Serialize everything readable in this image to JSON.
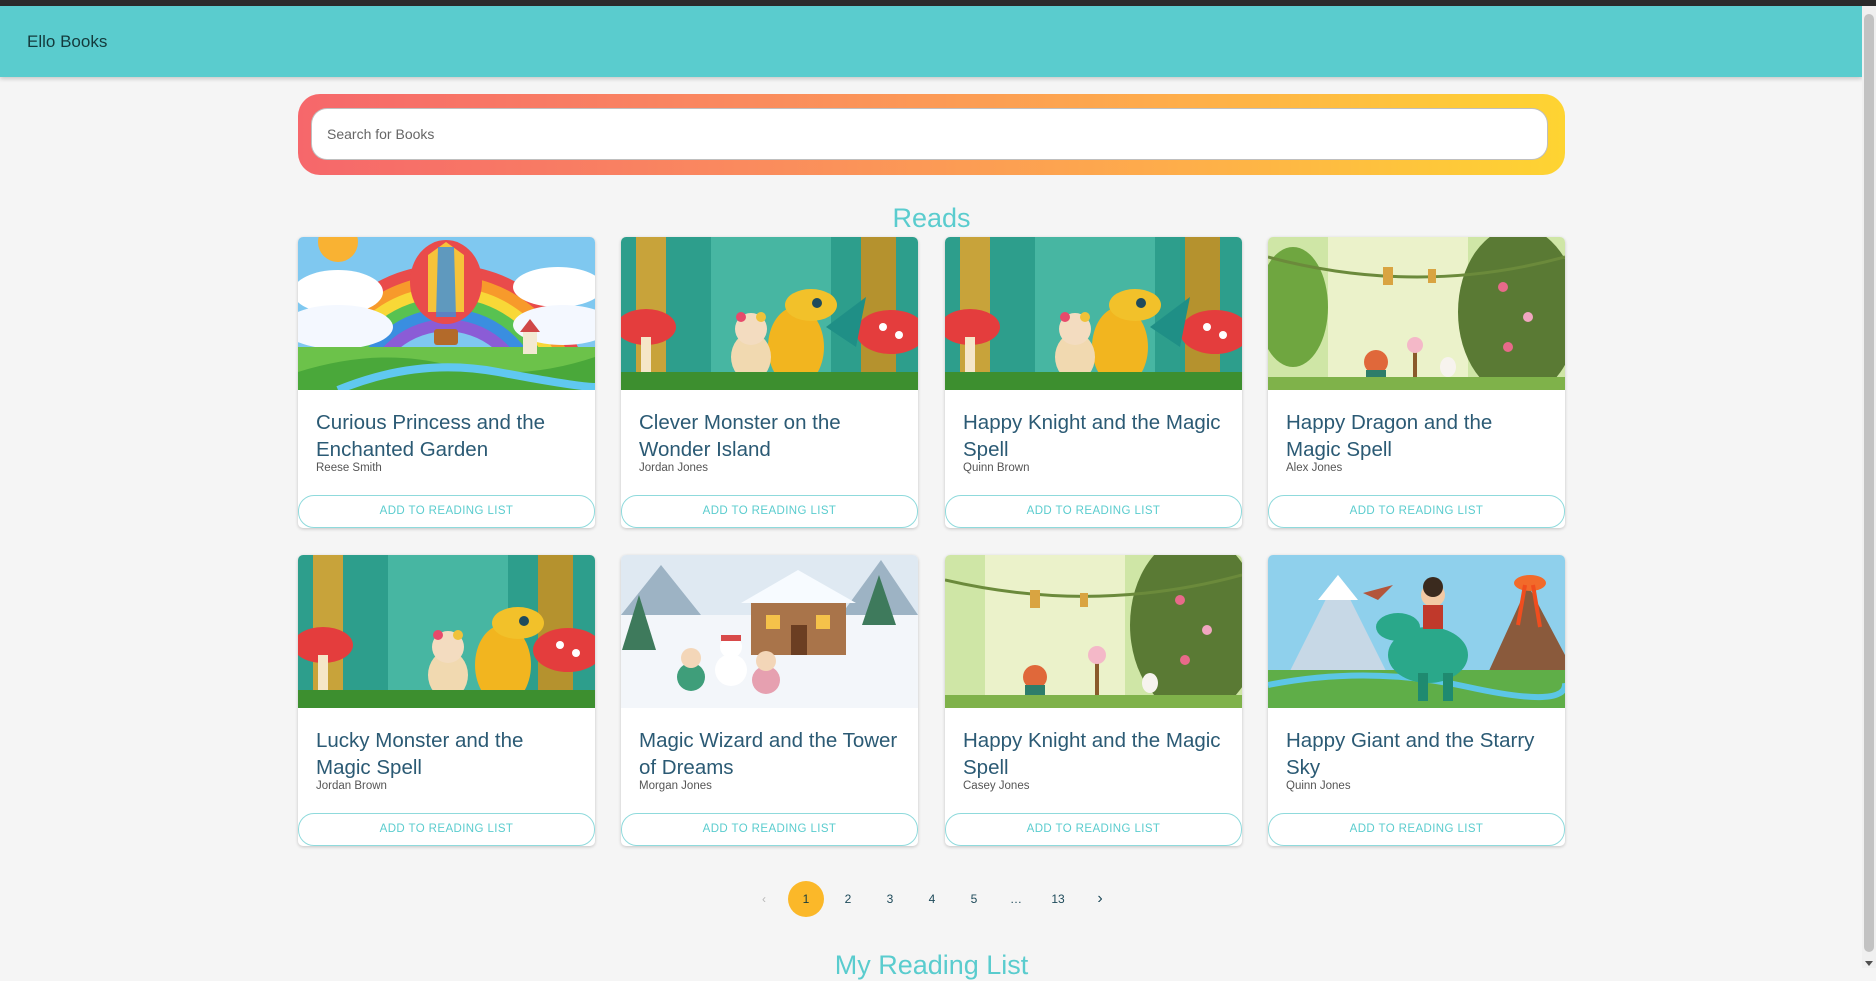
{
  "app": {
    "title": "Ello Books"
  },
  "search": {
    "placeholder": "Search for Books"
  },
  "sections": {
    "reads_title": "Reads",
    "reading_list_title": "My Reading List"
  },
  "books": [
    {
      "title": "Curious Princess and the Enchanted Garden",
      "author": "Reese Smith",
      "action": "ADD TO READING LIST",
      "cover": "rainbow-balloon"
    },
    {
      "title": "Clever Monster on the Wonder Island",
      "author": "Jordan Jones",
      "action": "ADD TO READING LIST",
      "cover": "dragon-forest"
    },
    {
      "title": "Happy Knight and the Magic Spell",
      "author": "Quinn Brown",
      "action": "ADD TO READING LIST",
      "cover": "dragon-forest"
    },
    {
      "title": "Happy Dragon and the Magic Spell",
      "author": "Alex Jones",
      "action": "ADD TO READING LIST",
      "cover": "tea-party-garden"
    },
    {
      "title": "Lucky Monster and the Magic Spell",
      "author": "Jordan Brown",
      "action": "ADD TO READING LIST",
      "cover": "dragon-forest"
    },
    {
      "title": "Magic Wizard and the Tower of Dreams",
      "author": "Morgan Jones",
      "action": "ADD TO READING LIST",
      "cover": "snow-cabin"
    },
    {
      "title": "Happy Knight and the Magic Spell",
      "author": "Casey Jones",
      "action": "ADD TO READING LIST",
      "cover": "tea-party-garden"
    },
    {
      "title": "Happy Giant and the Starry Sky",
      "author": "Quinn Jones",
      "action": "ADD TO READING LIST",
      "cover": "dinosaur-volcano"
    }
  ],
  "pagination": {
    "current": "1",
    "prev_icon": "chevron-left-icon",
    "next_icon": "chevron-right-icon",
    "items": [
      "1",
      "2",
      "3",
      "4",
      "5",
      "…",
      "13"
    ]
  },
  "colors": {
    "appbar": "#5accce",
    "accent": "#5accce",
    "active_page": "#fbb829",
    "title_text": "#2b5a74"
  }
}
